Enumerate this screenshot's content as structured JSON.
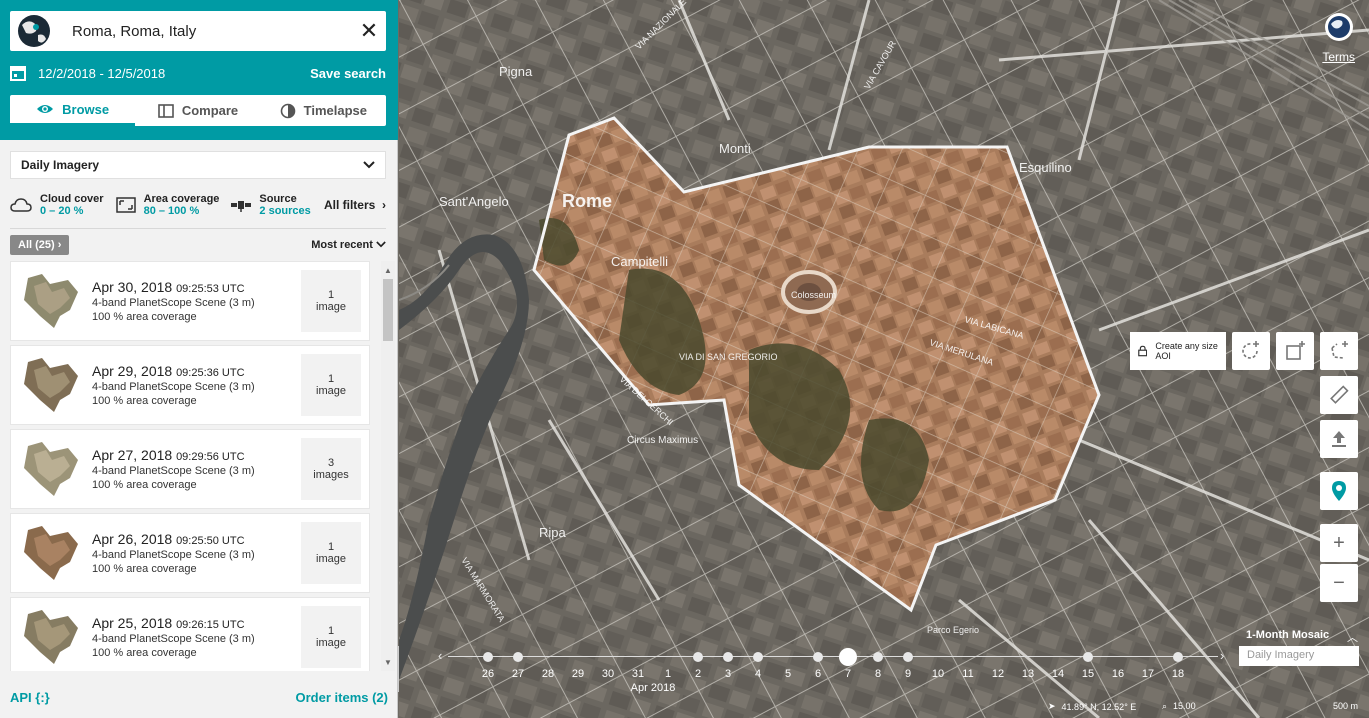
{
  "search": {
    "location": "Roma, Roma, Italy"
  },
  "date_range": {
    "value": "12/2/2018 - 12/5/2018",
    "save_label": "Save search"
  },
  "tabs": [
    {
      "label": "Browse",
      "icon": "eye-icon"
    },
    {
      "label": "Compare",
      "icon": "compare-icon"
    },
    {
      "label": "Timelapse",
      "icon": "timelapse-icon"
    }
  ],
  "imagery_type": "Daily Imagery",
  "filters": {
    "cloud": {
      "label": "Cloud cover",
      "value": "0 – 20 %"
    },
    "area": {
      "label": "Area coverage",
      "value": "80 – 100 %"
    },
    "source": {
      "label": "Source",
      "value": "2 sources"
    },
    "all_label": "All filters"
  },
  "results": {
    "count_label": "All (25)",
    "sort_label": "Most recent"
  },
  "items": [
    {
      "date": "Apr 30, 2018",
      "time": "09:25:53 UTC",
      "scene": "4-band PlanetScope Scene (3 m)",
      "coverage": "100 % area coverage",
      "count": "1",
      "unit": "image"
    },
    {
      "date": "Apr 29, 2018",
      "time": "09:25:36 UTC",
      "scene": "4-band PlanetScope Scene (3 m)",
      "coverage": "100 % area coverage",
      "count": "1",
      "unit": "image"
    },
    {
      "date": "Apr 27, 2018",
      "time": "09:29:56 UTC",
      "scene": "4-band PlanetScope Scene (3 m)",
      "coverage": "100 % area coverage",
      "count": "3",
      "unit": "images"
    },
    {
      "date": "Apr 26, 2018",
      "time": "09:25:50 UTC",
      "scene": "4-band PlanetScope Scene (3 m)",
      "coverage": "100 % area coverage",
      "count": "1",
      "unit": "image"
    },
    {
      "date": "Apr 25, 2018",
      "time": "09:26:15 UTC",
      "scene": "4-band PlanetScope Scene (3 m)",
      "coverage": "100 % area coverage",
      "count": "1",
      "unit": "image"
    }
  ],
  "footer": {
    "api_label": "API {:}",
    "order_label": "Order items (2)"
  },
  "map": {
    "terms_label": "Terms",
    "aoi_tip": "Create any size AOI",
    "place_labels": [
      "Rome",
      "Monti",
      "Esquilino",
      "Pigna",
      "Sant'Angelo",
      "Campitelli",
      "Ripa",
      "Circus Maximus",
      "Colosseum",
      "Parco Egerio",
      "VIA LABICANA",
      "VIA MERULANA",
      "VIA DI SAN GREGORIO",
      "VIA MARMORATA",
      "VIA DEI CERCHI",
      "VIA CAVOUR",
      "VIA NAZIONALE"
    ],
    "mosaic_label": "1-Month Mosaic",
    "mosaic_select": "Daily Imagery",
    "timeline_labels": [
      "26",
      "27",
      "28",
      "29",
      "30",
      "31",
      "1",
      "2",
      "3",
      "4",
      "5",
      "6",
      "7",
      "8",
      "9",
      "10",
      "11",
      "12",
      "13",
      "14",
      "15",
      "16",
      "17",
      "18"
    ],
    "month_label": "Apr 2018",
    "coords": "41.89° N, 12.52° E",
    "zoom": "15.00",
    "scale": "500 m"
  }
}
